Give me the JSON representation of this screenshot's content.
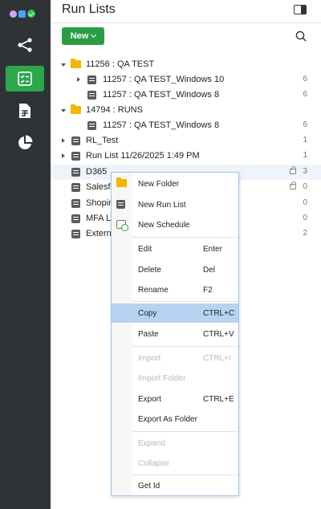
{
  "app": {
    "title": "Run Lists"
  },
  "toolbar": {
    "new_label": "New"
  },
  "rail": {
    "items": [
      {
        "icon": "flow-icon",
        "active": false
      },
      {
        "icon": "checklist-icon",
        "active": true
      },
      {
        "icon": "document-icon",
        "active": false
      },
      {
        "icon": "pie-chart-icon",
        "active": false
      }
    ]
  },
  "tree": {
    "rows": [
      {
        "label": "11256 : QA TEST",
        "count": ""
      },
      {
        "label": "11257 : QA TEST_Windows 10",
        "count": "6"
      },
      {
        "label": "11257 : QA TEST_Windows 8",
        "count": "6"
      },
      {
        "label": "14794 : RUNS",
        "count": ""
      },
      {
        "label": "11257 : QA TEST_Windows 8",
        "count": "6"
      },
      {
        "label": "RL_Test",
        "count": "1"
      },
      {
        "label": "Run List 11/26/2025 1:49 PM",
        "count": "1"
      },
      {
        "label": "D365",
        "count": "3"
      },
      {
        "label": "Salesfo",
        "count": "0"
      },
      {
        "label": "Shopin",
        "count": "0"
      },
      {
        "label": "MFA L",
        "count": "0"
      },
      {
        "label": "Extern",
        "count": "2"
      }
    ]
  },
  "context_menu": {
    "items": [
      {
        "label": "New Folder",
        "shortcut": "",
        "icon": "folder-icon"
      },
      {
        "label": "New Run List",
        "shortcut": "",
        "icon": "run-list-icon"
      },
      {
        "label": "New Schedule",
        "shortcut": "",
        "icon": "schedule-icon"
      },
      {
        "label": "Edit",
        "shortcut": "Enter"
      },
      {
        "label": "Delete",
        "shortcut": "Del"
      },
      {
        "label": "Rename",
        "shortcut": "F2"
      },
      {
        "label": "Copy",
        "shortcut": "CTRL+C",
        "highlighted": true
      },
      {
        "label": "Paste",
        "shortcut": "CTRL+V"
      },
      {
        "label": "Import",
        "shortcut": "CTRL+I",
        "disabled": true
      },
      {
        "label": "Import Folder",
        "shortcut": "",
        "disabled": true
      },
      {
        "label": "Export",
        "shortcut": "CTRL+E"
      },
      {
        "label": "Export As Folder",
        "shortcut": ""
      },
      {
        "label": "Expand",
        "shortcut": "",
        "disabled": true
      },
      {
        "label": "Collapse",
        "shortcut": "",
        "disabled": true
      },
      {
        "label": "Get Id",
        "shortcut": ""
      }
    ]
  },
  "colors": {
    "rail_bg": "#2f3336",
    "accent_green": "#2b9e43",
    "menu_highlight": "#b7d3f1",
    "folder": "#f4b400"
  }
}
